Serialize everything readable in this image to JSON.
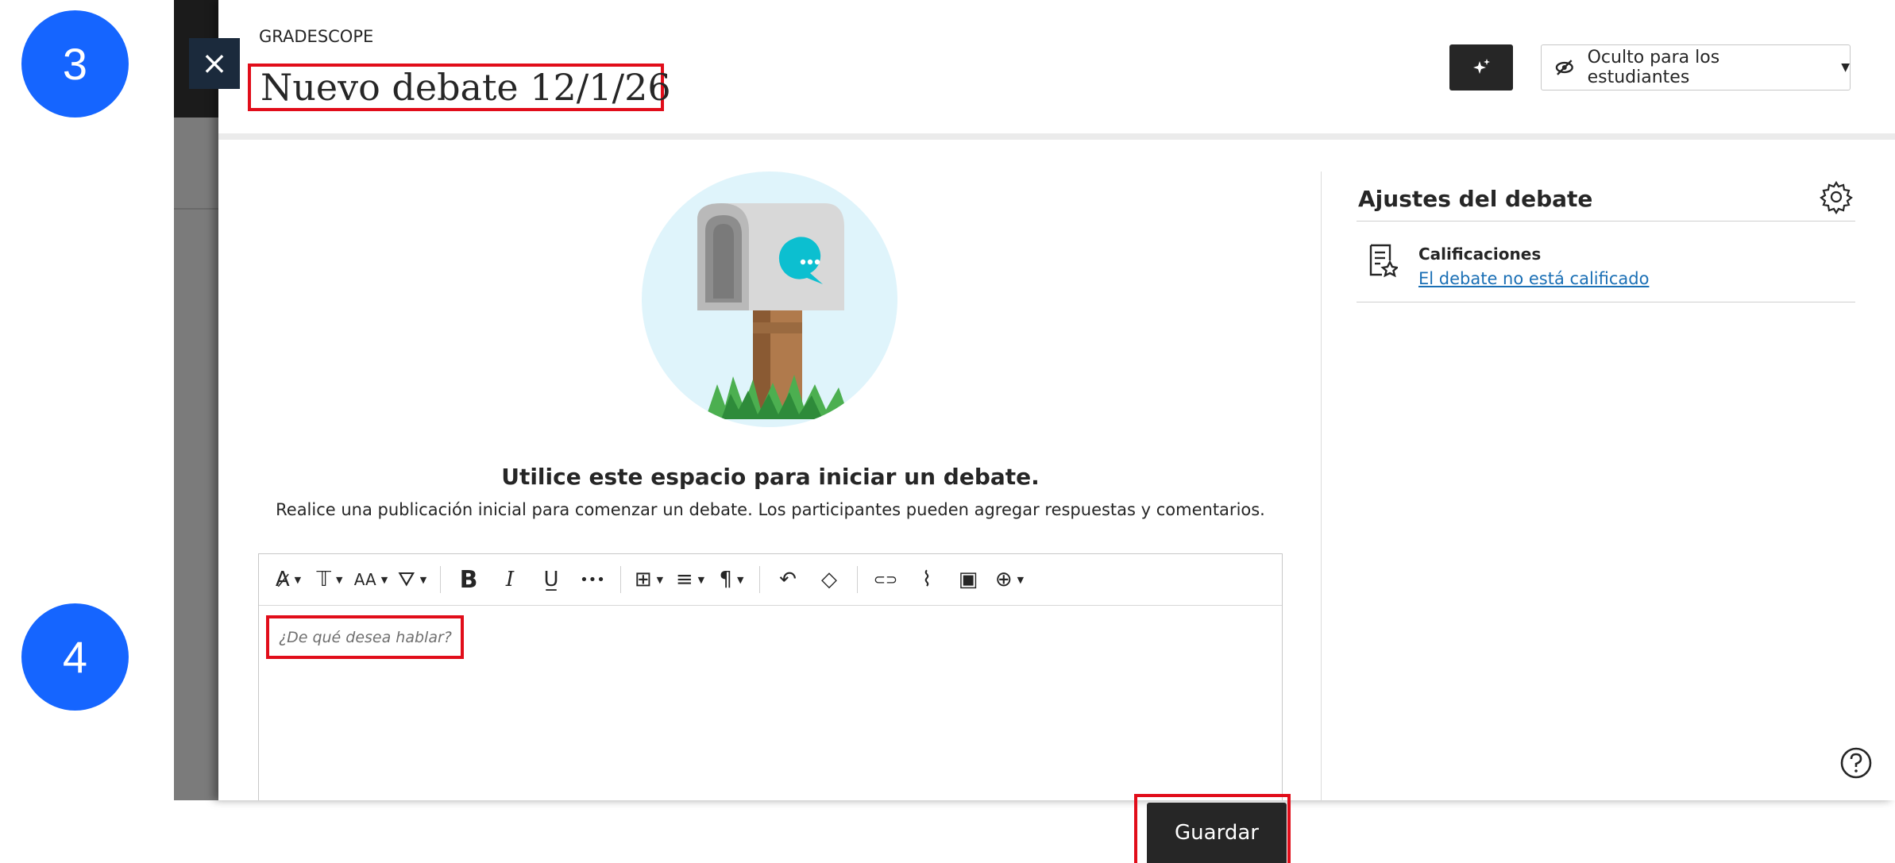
{
  "annotations": {
    "step_a": "3",
    "step_b": "4"
  },
  "close_button": {
    "label": "×"
  },
  "header": {
    "kicker": "GRADESCOPE",
    "title": "Nuevo debate 12/1/26",
    "magic_icon": "sparkle-icon",
    "visibility": {
      "label": "Oculto para los estudiantes",
      "icon": "eye-slash-icon"
    }
  },
  "main": {
    "heading": "Utilice este espacio para iniciar un debate.",
    "subheading": "Realice una publicación inicial para comenzar un debate. Los participantes pueden agregar respuestas y comentarios.",
    "editor": {
      "placeholder": "¿De qué desea hablar?",
      "toolbar": [
        {
          "icon": "text-style-icon",
          "glyph": "A̷",
          "dropdown": true
        },
        {
          "icon": "font-family-icon",
          "glyph": "𝕋",
          "dropdown": true
        },
        {
          "icon": "font-size-icon",
          "glyph": "AA",
          "dropdown": true
        },
        {
          "icon": "paint-bucket-icon",
          "glyph": "⛛",
          "dropdown": true
        },
        {
          "icon": "bold-icon",
          "glyph": "B",
          "dropdown": false
        },
        {
          "icon": "italic-icon",
          "glyph": "I",
          "dropdown": false
        },
        {
          "icon": "underline-icon",
          "glyph": "U̲",
          "dropdown": false
        },
        {
          "icon": "more-icon",
          "glyph": "•••",
          "dropdown": false
        },
        {
          "icon": "table-icon",
          "glyph": "⊞",
          "dropdown": true
        },
        {
          "icon": "align-icon",
          "glyph": "≡",
          "dropdown": true
        },
        {
          "icon": "paragraph-icon",
          "glyph": "¶",
          "dropdown": true
        },
        {
          "icon": "undo-icon",
          "glyph": "↶",
          "dropdown": false
        },
        {
          "icon": "eraser-icon",
          "glyph": "◇",
          "dropdown": false
        },
        {
          "icon": "link-icon",
          "glyph": "⊂⊃",
          "dropdown": false
        },
        {
          "icon": "attachment-icon",
          "glyph": "⌇",
          "dropdown": false
        },
        {
          "icon": "image-icon",
          "glyph": "▣",
          "dropdown": false
        },
        {
          "icon": "insert-icon",
          "glyph": "⊕",
          "dropdown": true
        }
      ]
    },
    "save_label": "Guardar"
  },
  "settings": {
    "title": "Ajustes del debate",
    "grades_label": "Calificaciones",
    "grades_link": "El debate no está calificado"
  },
  "colors": {
    "highlight": "#e10d1a",
    "badge": "#1565ff",
    "link": "#1a6fb5",
    "dark_button": "#262626"
  }
}
